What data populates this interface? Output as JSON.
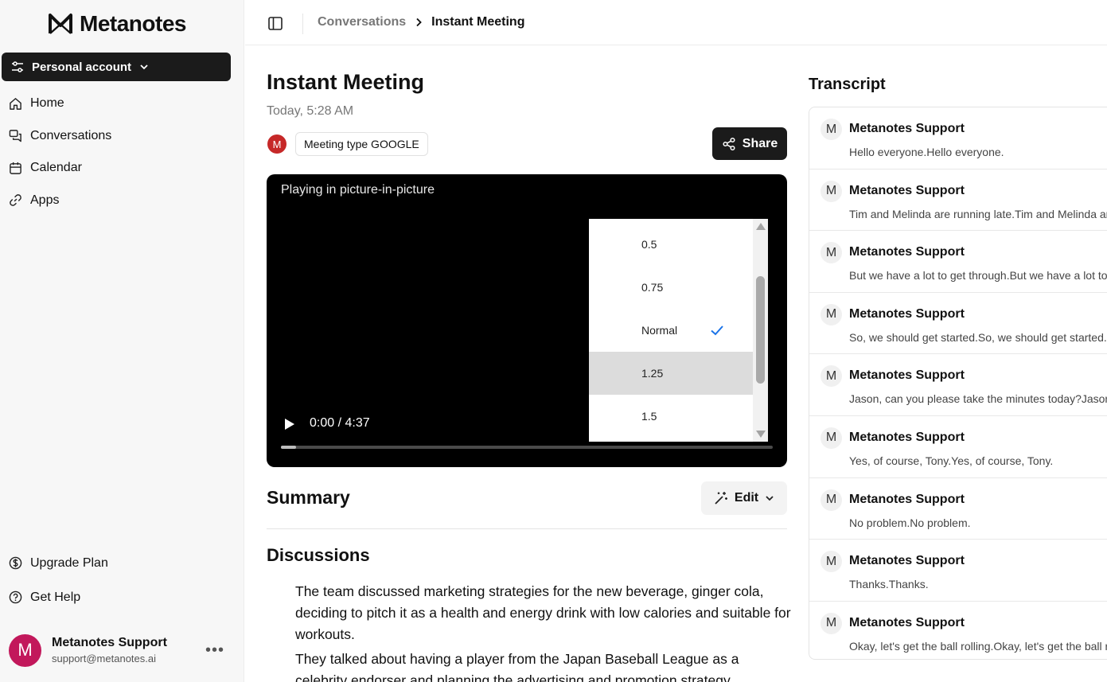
{
  "brand": {
    "name": "Metanotes"
  },
  "sidebar": {
    "account_label": "Personal account",
    "nav": [
      {
        "label": "Home",
        "icon": "home-icon"
      },
      {
        "label": "Conversations",
        "icon": "conversations-icon"
      },
      {
        "label": "Calendar",
        "icon": "calendar-icon"
      },
      {
        "label": "Apps",
        "icon": "link-icon"
      }
    ],
    "bottom": [
      {
        "label": "Upgrade Plan",
        "icon": "dollar-icon"
      },
      {
        "label": "Get Help",
        "icon": "help-icon"
      }
    ],
    "user": {
      "initial": "M",
      "name": "Metanotes Support",
      "email": "support@metanotes.ai"
    }
  },
  "breadcrumb": {
    "parent": "Conversations",
    "current": "Instant Meeting"
  },
  "meeting": {
    "title": "Instant Meeting",
    "date": "Today, 5:28 AM",
    "participant_initial": "M",
    "type_badge": "Meeting type GOOGLE",
    "share_label": "Share"
  },
  "video": {
    "pip_label": "Playing in picture-in-picture",
    "time": "0:00 / 4:37",
    "progress": 0.03,
    "speed_options": [
      "0.5",
      "0.75",
      "Normal",
      "1.25",
      "1.5"
    ],
    "selected_speed": "Normal",
    "hovered_speed": "1.25"
  },
  "summary": {
    "title": "Summary",
    "edit_label": "Edit",
    "discussions_title": "Discussions",
    "items": [
      "The team discussed marketing strategies for the new beverage, ginger cola, deciding to pitch it as a health and energy drink with low calories and suitable for workouts.",
      "They talked about having a player from the Japan Baseball League as a celebrity endorser and planning the advertising and promotion strategy."
    ]
  },
  "transcript": {
    "title": "Transcript",
    "entries": [
      {
        "initial": "M",
        "speaker": "Metanotes Support",
        "text": "Hello everyone.Hello everyone."
      },
      {
        "initial": "M",
        "speaker": "Metanotes Support",
        "text": "Tim and Melinda are running late.Tim and Melinda are running late."
      },
      {
        "initial": "M",
        "speaker": "Metanotes Support",
        "text": "But we have a lot to get through.But we have a lot to get through."
      },
      {
        "initial": "M",
        "speaker": "Metanotes Support",
        "text": "So, we should get started.So, we should get started."
      },
      {
        "initial": "M",
        "speaker": "Metanotes Support",
        "text": "Jason, can you please take the minutes today?Jason, can you please take the minutes today?"
      },
      {
        "initial": "M",
        "speaker": "Metanotes Support",
        "text": "Yes, of course, Tony.Yes, of course, Tony."
      },
      {
        "initial": "M",
        "speaker": "Metanotes Support",
        "text": "No problem.No problem."
      },
      {
        "initial": "M",
        "speaker": "Metanotes Support",
        "text": "Thanks.Thanks."
      },
      {
        "initial": "M",
        "speaker": "Metanotes Support",
        "text": "Okay, let's get the ball rolling.Okay, let's get the ball rolling."
      }
    ]
  },
  "colors": {
    "accent_dark": "#1b1b1b",
    "avatar": "#c2185b",
    "check": "#1a73e8"
  }
}
